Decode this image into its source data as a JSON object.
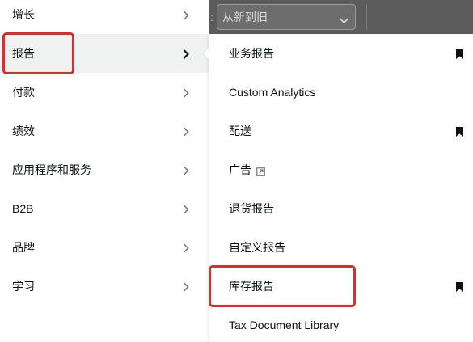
{
  "background_page": {
    "sort_label_tail": ":",
    "sort_dropdown": {
      "value": "从新到旧"
    }
  },
  "left_menu": {
    "items": [
      {
        "label": "增长",
        "selected": false,
        "annotated": false
      },
      {
        "label": "报告",
        "selected": true,
        "annotated": true
      },
      {
        "label": "付款",
        "selected": false,
        "annotated": false
      },
      {
        "label": "绩效",
        "selected": false,
        "annotated": false
      },
      {
        "label": "应用程序和服务",
        "selected": false,
        "annotated": false
      },
      {
        "label": "B2B",
        "selected": false,
        "annotated": false
      },
      {
        "label": "品牌",
        "selected": false,
        "annotated": false
      },
      {
        "label": "学习",
        "selected": false,
        "annotated": false
      }
    ]
  },
  "submenu": {
    "items": [
      {
        "label": "业务报告",
        "bookmarked": true,
        "external": false,
        "annotated": false
      },
      {
        "label": "Custom Analytics",
        "bookmarked": false,
        "external": false,
        "annotated": false
      },
      {
        "label": "配送",
        "bookmarked": true,
        "external": false,
        "annotated": false
      },
      {
        "label": "广告",
        "bookmarked": false,
        "external": true,
        "annotated": false
      },
      {
        "label": "退货报告",
        "bookmarked": false,
        "external": false,
        "annotated": false
      },
      {
        "label": "自定义报告",
        "bookmarked": false,
        "external": false,
        "annotated": false
      },
      {
        "label": "库存报告",
        "bookmarked": true,
        "external": false,
        "annotated": true
      },
      {
        "label": "Tax Document Library",
        "bookmarked": false,
        "external": false,
        "annotated": false
      }
    ]
  },
  "icons": {
    "menu_item_arrow": "chevron-right-icon",
    "submenu_pin": "bookmark-icon",
    "external_link": "external-link-icon",
    "dropdown_caret": "chevron-down-icon"
  },
  "colors": {
    "annotation_outline": "#e02b2b",
    "selected_row_bg": "#f0f2f2",
    "text": "#0f1111",
    "overlay_bg": "#5c5c5c"
  }
}
